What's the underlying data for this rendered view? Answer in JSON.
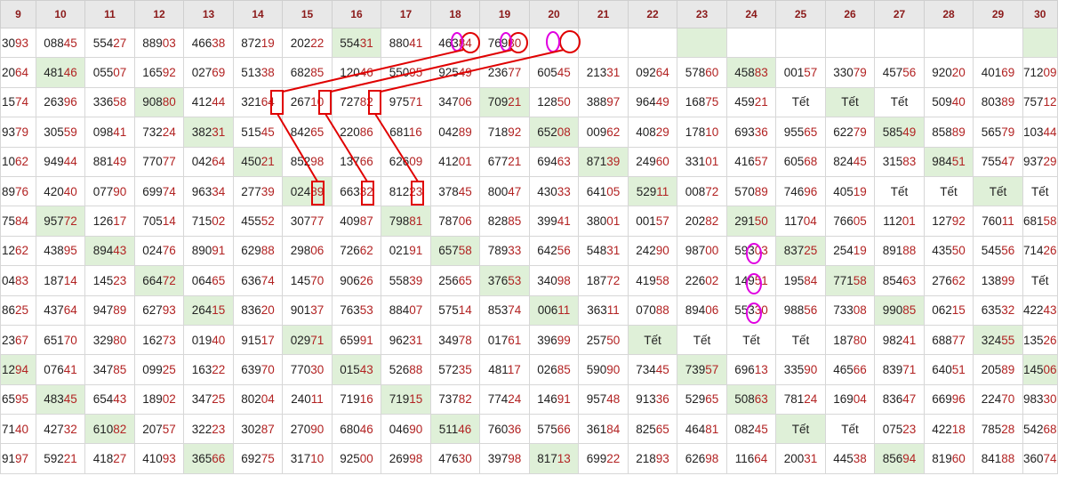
{
  "headers": [
    "9",
    "10",
    "11",
    "12",
    "13",
    "14",
    "15",
    "16",
    "17",
    "18",
    "19",
    "20",
    "21",
    "22",
    "23",
    "24",
    "25",
    "26",
    "27",
    "28",
    "29",
    "30"
  ],
  "rows": [
    [
      "3093",
      "08845",
      "55427",
      "88903",
      "46638",
      "87219",
      "20222",
      "55431",
      "88041",
      "46384",
      "76930",
      "",
      "",
      "",
      "",
      "",
      "",
      "",
      "",
      "",
      "",
      ""
    ],
    [
      "2064",
      "48146",
      "05507",
      "16592",
      "02769",
      "51338",
      "68285",
      "12046",
      "55095",
      "92549",
      "23677",
      "60545",
      "21331",
      "09264",
      "57860",
      "45883",
      "00157",
      "33079",
      "45756",
      "92020",
      "40169",
      "71209"
    ],
    [
      "1574",
      "26396",
      "33658",
      "90880",
      "41244",
      "32164",
      "26710",
      "72782",
      "97571",
      "34706",
      "70921",
      "12850",
      "38897",
      "96449",
      "16875",
      "45921",
      "Tết",
      "Tết",
      "Tết",
      "50940",
      "80389",
      "75712"
    ],
    [
      "9379",
      "30559",
      "09841",
      "73224",
      "38231",
      "51545",
      "84265",
      "22086",
      "68116",
      "04289",
      "71892",
      "65208",
      "00962",
      "40829",
      "17810",
      "69336",
      "95565",
      "62279",
      "58549",
      "85889",
      "56579",
      "10344"
    ],
    [
      "1062",
      "94944",
      "88149",
      "77077",
      "04264",
      "45021",
      "85298",
      "13766",
      "62609",
      "41201",
      "67721",
      "69463",
      "87139",
      "24960",
      "33101",
      "41657",
      "60568",
      "82445",
      "31583",
      "98451",
      "75547",
      "93729"
    ],
    [
      "8976",
      "42040",
      "07790",
      "69974",
      "96334",
      "27739",
      "02489",
      "66332",
      "81223",
      "37845",
      "80047",
      "43033",
      "64105",
      "52911",
      "00872",
      "57089",
      "74696",
      "40519",
      "Tết",
      "Tết",
      "Tết",
      "Tết"
    ],
    [
      "7584",
      "95772",
      "12617",
      "70514",
      "71502",
      "45552",
      "30777",
      "40987",
      "79881",
      "78706",
      "82885",
      "39941",
      "38001",
      "00157",
      "20282",
      "29150",
      "11704",
      "76605",
      "11201",
      "12792",
      "76011",
      "68158"
    ],
    [
      "1262",
      "43895",
      "89443",
      "02476",
      "89091",
      "62988",
      "29806",
      "72662",
      "02191",
      "65758",
      "78933",
      "64256",
      "54831",
      "24290",
      "98700",
      "59303",
      "83725",
      "25419",
      "89188",
      "43550",
      "54556",
      "71426"
    ],
    [
      "0483",
      "18714",
      "14523",
      "66472",
      "06465",
      "63674",
      "14570",
      "90626",
      "55839",
      "25665",
      "37653",
      "34098",
      "18772",
      "41958",
      "22602",
      "14951",
      "19584",
      "77158",
      "85463",
      "27662",
      "13899",
      "Tết"
    ],
    [
      "8625",
      "43764",
      "94789",
      "62793",
      "26415",
      "83620",
      "90137",
      "76353",
      "88407",
      "57514",
      "85374",
      "00611",
      "36311",
      "07088",
      "89406",
      "55330",
      "98856",
      "73308",
      "99085",
      "06215",
      "63532",
      "42243"
    ],
    [
      "2367",
      "65170",
      "32980",
      "16273",
      "01940",
      "91517",
      "02971",
      "65991",
      "96231",
      "34978",
      "01761",
      "39699",
      "25750",
      "Tết",
      "Tết",
      "Tết",
      "Tết",
      "18780",
      "98241",
      "68877",
      "32455",
      "13526"
    ],
    [
      "1294",
      "07641",
      "34785",
      "09925",
      "16322",
      "63970",
      "77030",
      "01543",
      "52688",
      "57235",
      "48117",
      "02685",
      "59090",
      "73445",
      "73957",
      "69613",
      "33590",
      "46566",
      "83971",
      "64051",
      "20589",
      "14506"
    ],
    [
      "6595",
      "48345",
      "65443",
      "18902",
      "34725",
      "80204",
      "24011",
      "71916",
      "71915",
      "73782",
      "77424",
      "14691",
      "95748",
      "91336",
      "52965",
      "50863",
      "78124",
      "16904",
      "83647",
      "66996",
      "22470",
      "98330"
    ],
    [
      "7140",
      "42732",
      "61082",
      "20757",
      "32223",
      "30287",
      "27090",
      "68046",
      "04690",
      "51146",
      "76036",
      "57566",
      "36184",
      "82565",
      "46481",
      "08245",
      "Tết",
      "Tết",
      "07523",
      "42218",
      "78528",
      "54268"
    ],
    [
      "9197",
      "59221",
      "41827",
      "41093",
      "36566",
      "69275",
      "31710",
      "92500",
      "26998",
      "47630",
      "39798",
      "81713",
      "69922",
      "21893",
      "62698",
      "11664",
      "20031",
      "44538",
      "85694",
      "81960",
      "84188",
      "36074"
    ]
  ],
  "highlights": [
    [
      0,
      7
    ],
    [
      0,
      14
    ],
    [
      0,
      21
    ],
    [
      1,
      1
    ],
    [
      1,
      15
    ],
    [
      2,
      3
    ],
    [
      2,
      10
    ],
    [
      2,
      17
    ],
    [
      3,
      4
    ],
    [
      3,
      11
    ],
    [
      3,
      18
    ],
    [
      4,
      5
    ],
    [
      4,
      12
    ],
    [
      4,
      19
    ],
    [
      5,
      6
    ],
    [
      5,
      13
    ],
    [
      5,
      20
    ],
    [
      6,
      1
    ],
    [
      6,
      8
    ],
    [
      6,
      15
    ],
    [
      7,
      2
    ],
    [
      7,
      9
    ],
    [
      7,
      16
    ],
    [
      8,
      3
    ],
    [
      8,
      10
    ],
    [
      8,
      17
    ],
    [
      9,
      4
    ],
    [
      9,
      11
    ],
    [
      9,
      18
    ],
    [
      10,
      6
    ],
    [
      10,
      13
    ],
    [
      10,
      20
    ],
    [
      11,
      0
    ],
    [
      11,
      7
    ],
    [
      11,
      14
    ],
    [
      11,
      21
    ],
    [
      12,
      1
    ],
    [
      12,
      8
    ],
    [
      12,
      15
    ],
    [
      13,
      2
    ],
    [
      13,
      9
    ],
    [
      13,
      16
    ],
    [
      14,
      4
    ],
    [
      14,
      11
    ],
    [
      14,
      18
    ]
  ],
  "colors": {
    "header_bg": "#e8e8e8",
    "header_text": "#8b1a1a",
    "tail_text": "#b22222",
    "highlight_bg": "#dff0d8",
    "annotation_red": "#e00000",
    "annotation_magenta": "#e000e0"
  }
}
